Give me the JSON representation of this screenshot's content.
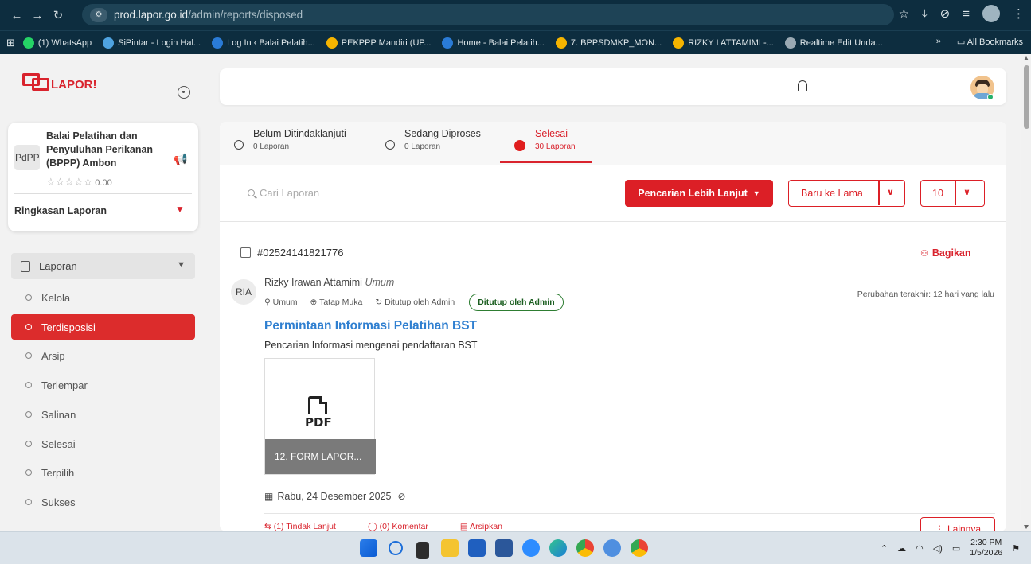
{
  "browser": {
    "url_host": "prod.lapor.go.id",
    "url_path": "/admin/reports/disposed",
    "bookmarks": [
      {
        "label": "(1) WhatsApp",
        "color": "#25d366"
      },
      {
        "label": "SiPintar - Login Hal...",
        "color": "#4fa3e0"
      },
      {
        "label": "Log In ‹ Balai Pelatih...",
        "color": "#2a7bd6"
      },
      {
        "label": "PEKPPP Mandiri (UP...",
        "color": "#f5b400"
      },
      {
        "label": "Home - Balai Pelatih...",
        "color": "#2a7bd6"
      },
      {
        "label": "7. BPPSDMKP_MON...",
        "color": "#f5b400"
      },
      {
        "label": "RIZKY I ATTAMIMI -...",
        "color": "#f5b400"
      },
      {
        "label": "Realtime Edit Unda...",
        "color": "#9aa9b3"
      }
    ],
    "more": "»",
    "all_bookmarks": "All Bookmarks"
  },
  "app": {
    "logo_text": "LAPOR!"
  },
  "instansi": {
    "avatar_text": "PdPP(",
    "name": "Balai Pelatihan dan Penyuluhan Perikanan (BPPP) Ambon",
    "stars": "☆☆☆☆☆",
    "score": "0.00",
    "summary_label": "Ringkasan Laporan"
  },
  "menu": {
    "section_label": "Laporan",
    "items": [
      {
        "label": "Kelola"
      },
      {
        "label": "Terdisposisi"
      },
      {
        "label": "Arsip"
      },
      {
        "label": "Terlempar"
      },
      {
        "label": "Salinan"
      },
      {
        "label": "Selesai"
      },
      {
        "label": "Terpilih"
      },
      {
        "label": "Sukses"
      }
    ],
    "active_index": 1
  },
  "tabs": [
    {
      "label": "Belum Ditindaklanjuti",
      "count": "0 Laporan"
    },
    {
      "label": "Sedang Diproses",
      "count": "0 Laporan"
    },
    {
      "label": "Selesai",
      "count": "30 Laporan"
    }
  ],
  "filters": {
    "search_placeholder": "Cari Laporan",
    "advanced_label": "Pencarian Lebih Lanjut",
    "sort_value": "Baru ke Lama",
    "per_page_value": "10"
  },
  "report": {
    "id": "#02524141821776",
    "share_label": "Bagikan",
    "avatar_initials": "RIA",
    "reporter_name": "Rizky Irawan Attamimi",
    "reporter_category": "Umum",
    "meta_privacy": "Umum",
    "meta_channel": "Tatap Muka",
    "meta_closed": "Ditutup oleh Admin",
    "status_pill": "Ditutup oleh Admin",
    "last_change": "Perubahan terakhir: 12 hari yang lalu",
    "title": "Permintaan Informasi Pelatihan BST",
    "description": "Pencarian Informasi mengenai pendaftaran BST",
    "attachment_type": "PDF",
    "attachment_caption": "12. FORM LAPOR...",
    "date": "Rabu, 24 Desember 2025",
    "actions": {
      "follow_up": "(1) Tindak Lanjut",
      "comments": "(0) Komentar",
      "archive": "Arsipkan"
    },
    "more_label": "Lainnya"
  },
  "taskbar": {
    "time": "2:30 PM",
    "date": "1/5/2026"
  }
}
